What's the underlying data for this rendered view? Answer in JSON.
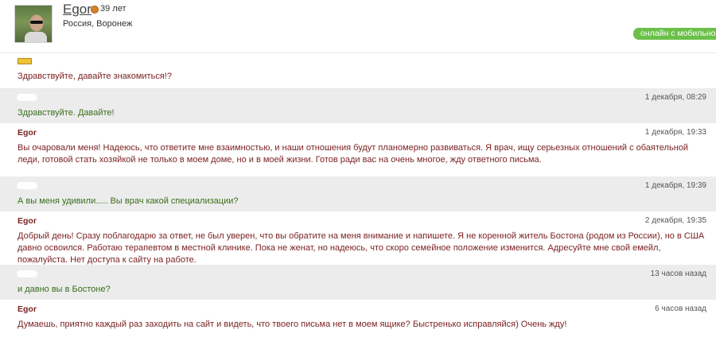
{
  "profile": {
    "name": "Egor",
    "age": "39 лет",
    "location": "Россия, Воронеж",
    "online_status": "онлайн с мобильного"
  },
  "colors": {
    "incoming_text": "#7a1f1f",
    "outgoing_text": "#3a6e1a",
    "online_badge": "#6cc04a",
    "outgoing_bg": "#ececec"
  },
  "messages": [
    {
      "direction": "incoming",
      "sender": "",
      "time": "",
      "text": "Здравствуйте, давайте знакомиться!?"
    },
    {
      "direction": "outgoing",
      "sender": "",
      "time": "1 декабря, 08:29",
      "text": "Здравствуйте. Давайте!"
    },
    {
      "direction": "incoming",
      "sender": "Egor",
      "time": "1 декабря, 19:33",
      "text": "Вы очаровали меня! Надеюсь, что ответите мне взаимностью, и наши отношения будут планомерно развиваться. Я врач, ищу серьезных отношений с обаятельной леди, готовой стать хозяйкой не только в моем доме, но и в моей жизни. Готов ради вас на очень многое, жду ответного письма."
    },
    {
      "direction": "outgoing",
      "sender": "",
      "time": "1 декабря, 19:39",
      "text": "А вы меня удивили..... Вы врач какой специализации?"
    },
    {
      "direction": "incoming",
      "sender": "Egor",
      "time": "2 декабря, 19:35",
      "text": "Добрый день! Сразу поблагодарю за ответ, не был уверен, что вы обратите на меня внимание и напишете. Я не коренной житель Бостона (родом из России), но в США давно освоился. Работаю терапевтом в местной клинике. Пока не женат, но надеюсь, что скоро семейное положение изменится. Адресуйте мне свой емейл, пожалуйста. Нет доступа к сайту на работе."
    },
    {
      "direction": "outgoing",
      "sender": "",
      "time": "13 часов назад",
      "text": "и давно вы в Бостоне?"
    },
    {
      "direction": "incoming",
      "sender": "Egor",
      "time": "6 часов назад",
      "text": "Думаешь, приятно каждый раз заходить на сайт и видеть, что твоего письма нет в моем ящике? Быстренько исправляйся) Очень жду!"
    }
  ]
}
